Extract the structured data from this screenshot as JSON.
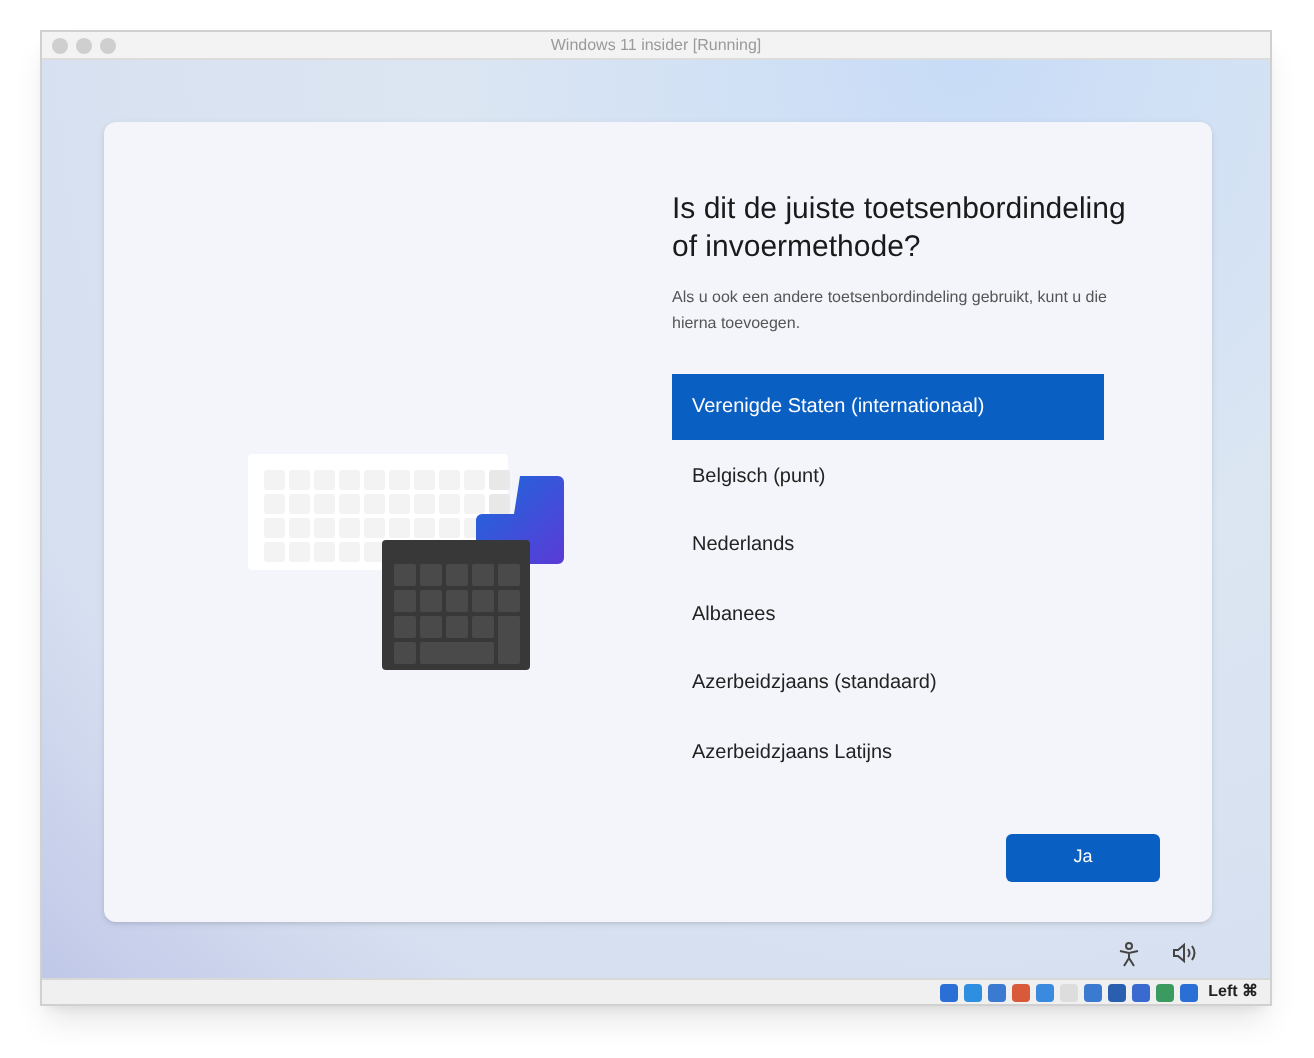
{
  "window": {
    "title": "Windows 11 insider [Running]"
  },
  "setup": {
    "heading": "Is dit de juiste toetsenbordindeling of invoermethode?",
    "description": "Als u ook een andere toetsenbordindeling gebruikt, kunt u die hierna toevoegen.",
    "layouts": [
      {
        "label": "Verenigde Staten (internationaal)",
        "selected": true
      },
      {
        "label": "Belgisch (punt)",
        "selected": false
      },
      {
        "label": "Nederlands",
        "selected": false
      },
      {
        "label": "Albanees",
        "selected": false
      },
      {
        "label": "Azerbeidzjaans (standaard)",
        "selected": false
      },
      {
        "label": "Azerbeidzjaans Latijns",
        "selected": false
      }
    ],
    "confirm_button": "Ja"
  },
  "status_bar": {
    "host_key": "Left ⌘"
  }
}
